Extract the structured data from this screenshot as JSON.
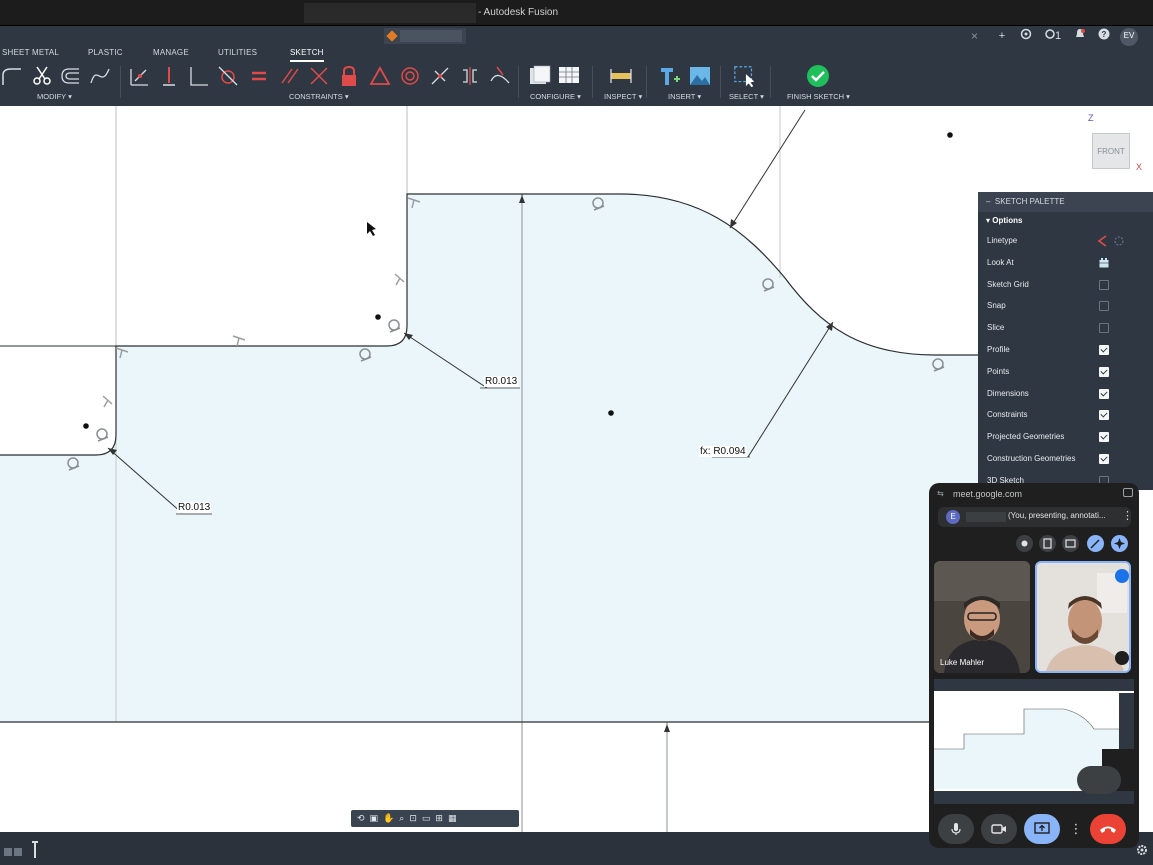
{
  "window": {
    "title": "- Autodesk Fusion"
  },
  "topbar": {
    "close_glyph": "×",
    "plus_glyph": "+",
    "jobs_count": "1",
    "user_initials": "EV"
  },
  "ribbon": {
    "tabs": [
      "SHEET METAL",
      "PLASTIC",
      "MANAGE",
      "UTILITIES",
      "SKETCH"
    ],
    "active_tab": "SKETCH",
    "groups": {
      "modify": "MODIFY ▾",
      "constraints": "CONSTRAINTS ▾",
      "configure": "CONFIGURE ▾",
      "inspect": "INSPECT ▾",
      "insert": "INSERT ▾",
      "select": "SELECT ▾",
      "finish": "FINISH SKETCH ▾"
    }
  },
  "viewcube": {
    "face": "FRONT",
    "z_label": "Z",
    "x_label": "X"
  },
  "dimensions": {
    "dim1": "R0.013",
    "dim2": "R0.013",
    "dim3": "fx: R0.094"
  },
  "sketch_palette": {
    "title": "SKETCH PALETTE",
    "section": "Options",
    "rows": [
      {
        "label": "Linetype",
        "control": "linetype-icon"
      },
      {
        "label": "Look At",
        "control": "look-at-icon"
      },
      {
        "label": "Sketch Grid",
        "checked": false
      },
      {
        "label": "Snap",
        "checked": false
      },
      {
        "label": "Slice",
        "checked": false
      },
      {
        "label": "Profile",
        "checked": true
      },
      {
        "label": "Points",
        "checked": true
      },
      {
        "label": "Dimensions",
        "checked": true
      },
      {
        "label": "Constraints",
        "checked": true
      },
      {
        "label": "Projected Geometries",
        "checked": true
      },
      {
        "label": "Construction Geometries",
        "checked": true
      },
      {
        "label": "3D Sketch",
        "checked": false
      }
    ]
  },
  "meet": {
    "url": "meet.google.com",
    "presenter_initial": "E",
    "presenting_text": "(You, presenting, annotati...",
    "participant_1": "Luke Mahler"
  },
  "colors": {
    "profile_fill": "#eaf6f9",
    "toolbar_bg": "#2f3742",
    "finish_green": "#1fbf5b",
    "constraint_red": "#e04a4a",
    "end_call": "#ea4335",
    "present_blue": "#8ab4f8"
  }
}
